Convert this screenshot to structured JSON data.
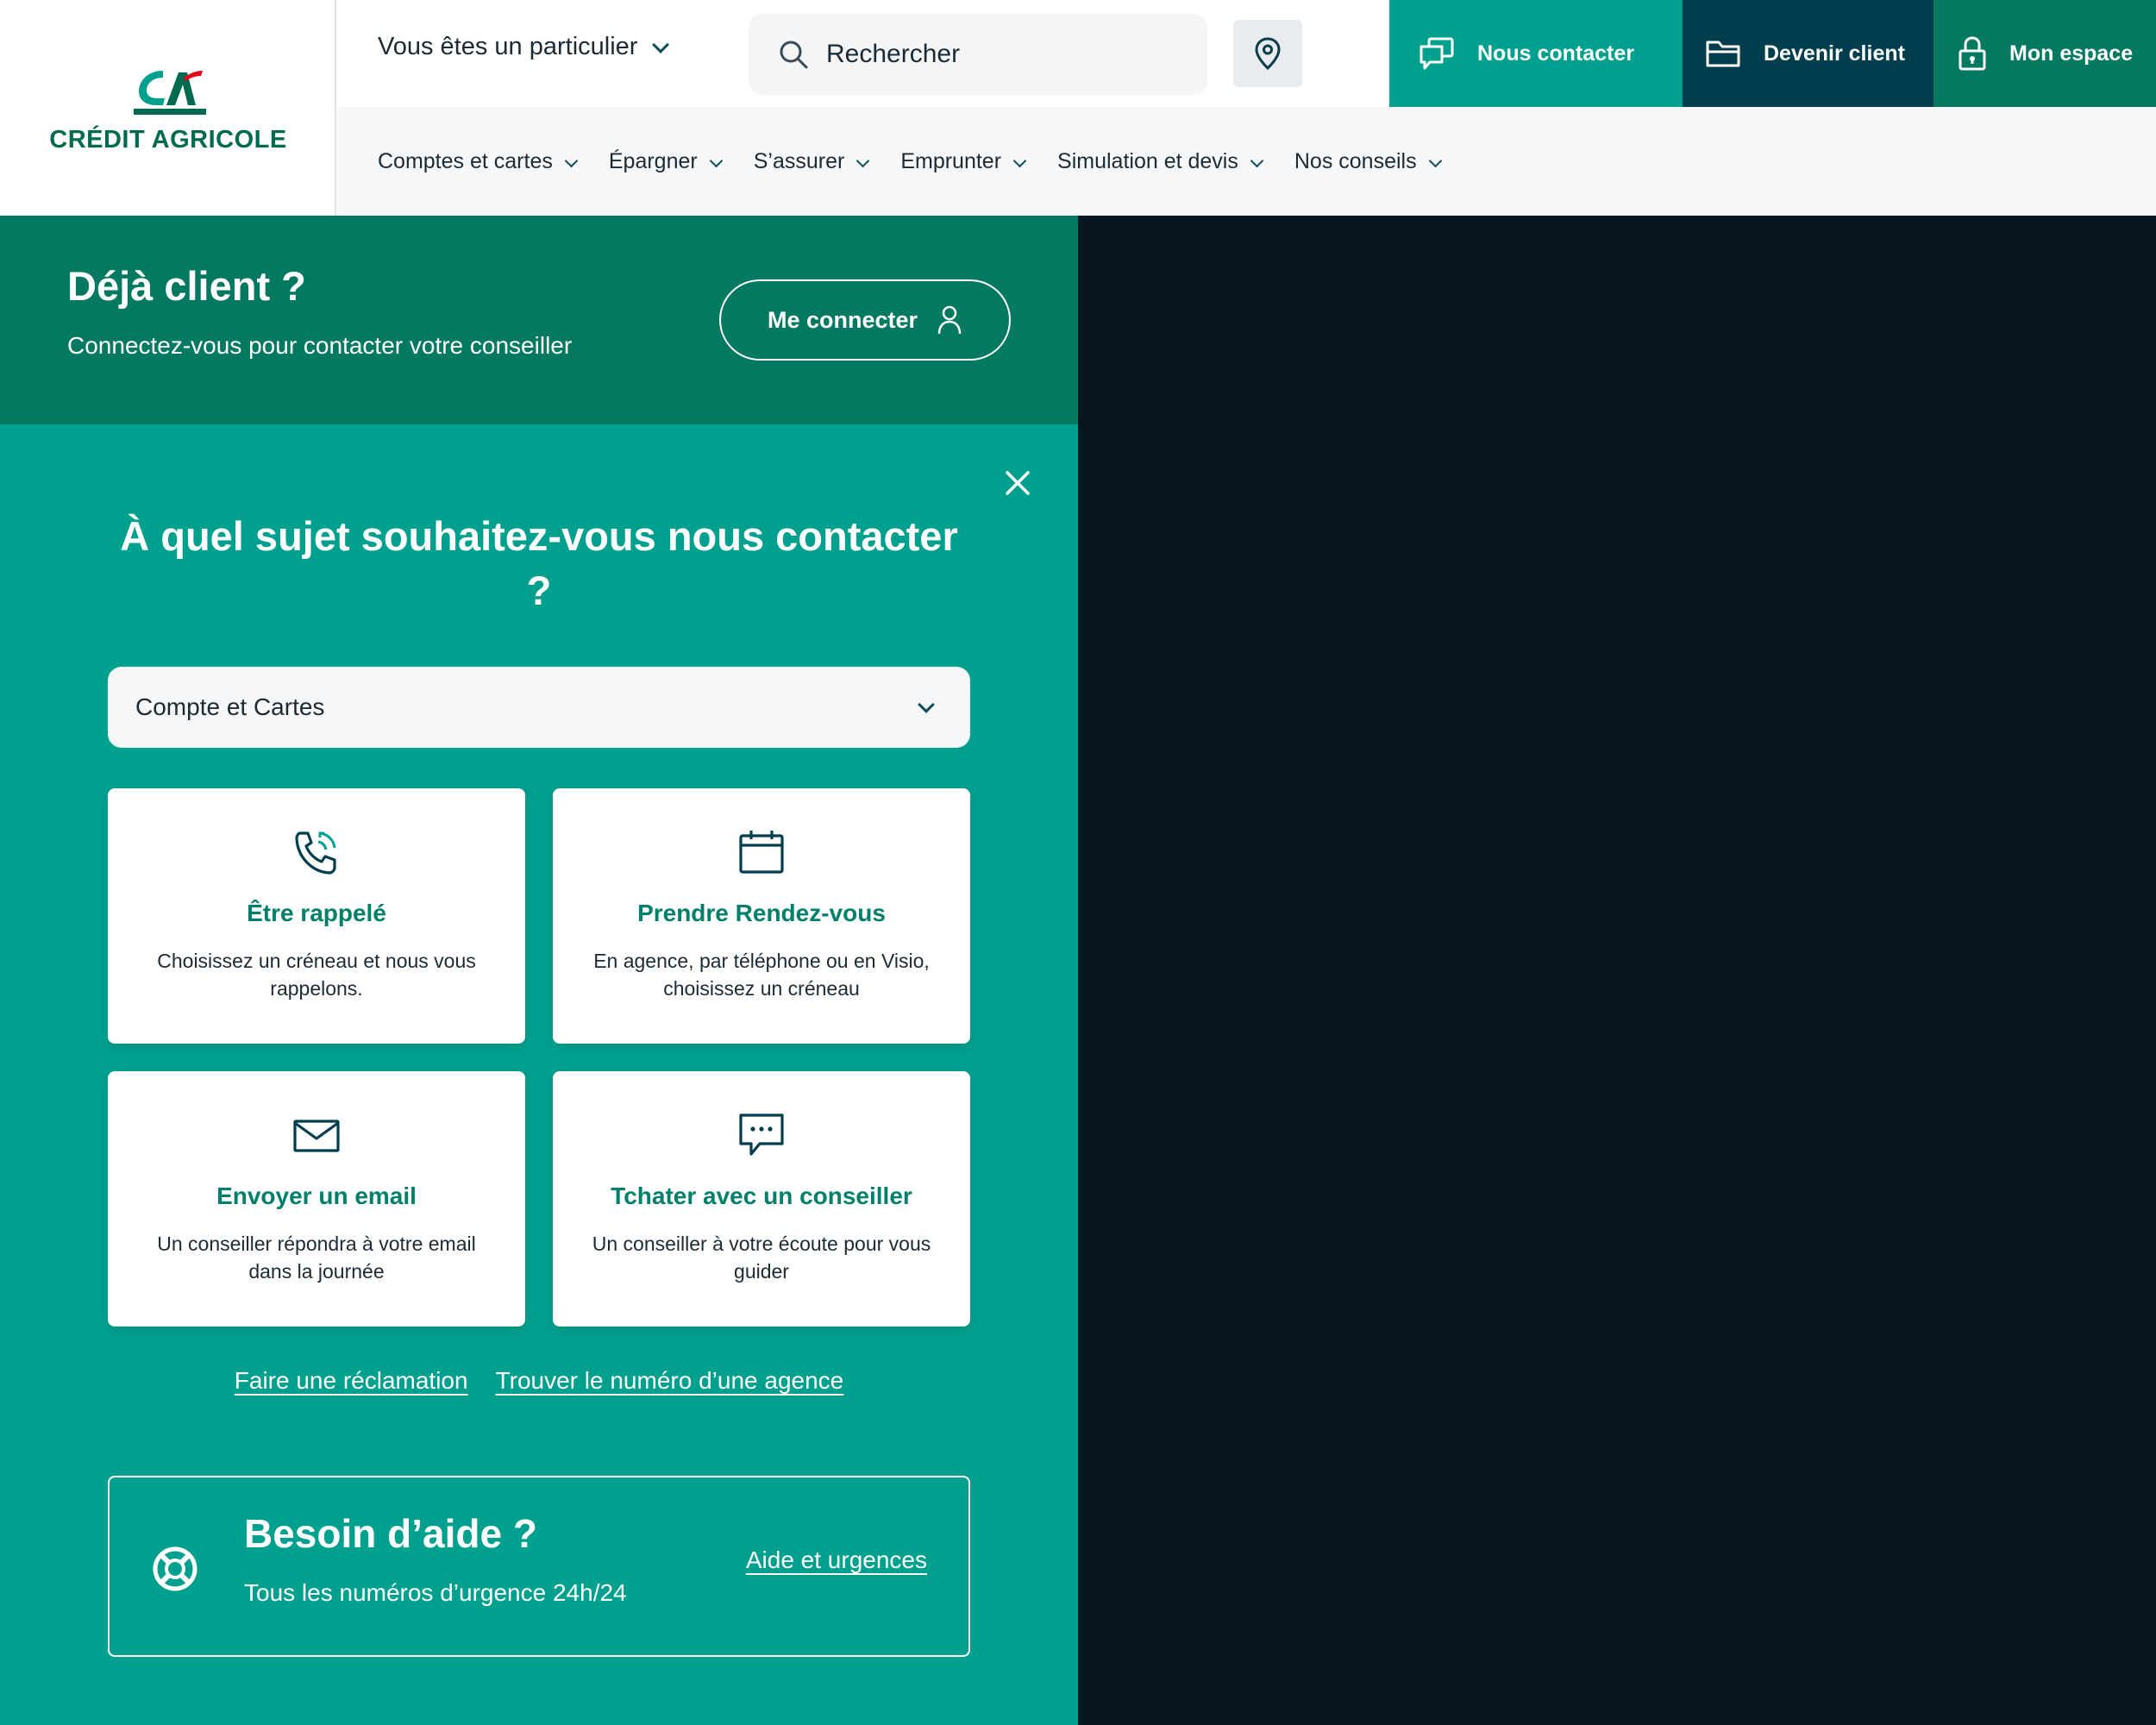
{
  "brand": {
    "name": "CRÉDIT AGRICOLE",
    "green": "#006a4e",
    "teal": "#00a08f",
    "dark_teal": "#003e4d",
    "mid_green": "#047961"
  },
  "header": {
    "persona_label": "Vous êtes un particulier",
    "search_placeholder": "Rechercher",
    "actions": {
      "contact": "Nous contacter",
      "become_client": "Devenir client",
      "my_space": "Mon espace"
    }
  },
  "nav": {
    "items": [
      {
        "label": "Comptes et cartes"
      },
      {
        "label": "Épargner"
      },
      {
        "label": "S’assurer"
      },
      {
        "label": "Emprunter"
      },
      {
        "label": "Simulation et devis"
      },
      {
        "label": "Nos conseils"
      }
    ]
  },
  "login": {
    "title": "Déjà client ?",
    "subtitle": "Connectez-vous pour contacter votre conseiller",
    "button": "Me connecter"
  },
  "contact": {
    "question": "À quel sujet souhaitez-vous nous contacter ?",
    "topic_selected": "Compte et Cartes",
    "cards": [
      {
        "icon": "phone-callback-icon",
        "title": "Être rappelé",
        "desc": "Choisissez un créneau et nous vous rappelons."
      },
      {
        "icon": "calendar-icon",
        "title": "Prendre Rendez-vous",
        "desc": "En agence, par téléphone ou en Visio, choisissez un créneau"
      },
      {
        "icon": "envelope-icon",
        "title": "Envoyer un email",
        "desc": "Un conseiller répondra à votre email dans la journée"
      },
      {
        "icon": "chat-bubble-icon",
        "title": "Tchater avec un conseiller",
        "desc": "Un conseiller à votre écoute pour vous guider"
      }
    ],
    "links": {
      "complaint": "Faire une réclamation",
      "agency_number": "Trouver le numéro d’une agence"
    }
  },
  "help": {
    "title": "Besoin d’aide ?",
    "subtitle": "Tous les numéros d’urgence 24h/24",
    "link": "Aide et urgences"
  }
}
